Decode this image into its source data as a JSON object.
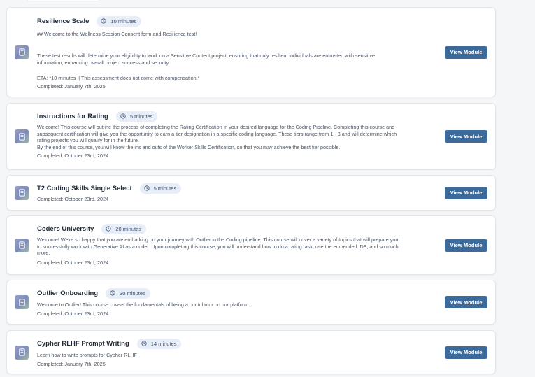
{
  "modules": [
    {
      "title": "Resilience Scale",
      "duration": "10 minutes",
      "description_lines": [
        "## Welcome to the Wellness Session Consent form and Resilience test!",
        "",
        "",
        "These test results will determine your eligibility to work on a Sensitive Content project, ensuring that only resilient individuals are entrusted with sensitive",
        "information, enhancing overall project success and security.",
        "",
        "ETA: *10 minutes || This assessment does not come with compensation.*"
      ],
      "completed": "Completed: January 7th, 2025",
      "button": "View Module"
    },
    {
      "title": "Instructions for Rating",
      "duration": "5 minutes",
      "description_lines": [
        "Welcome! This course will outline the process of completing the Rating Certification in your desired language for the Coding Pipeline. Completing this course and",
        "subsequent certification will give you the opportunity to earn a tier designation in a specific coding language. These tiers range from 1 - 3 and will determine which",
        "rating projects you will qualify for in the future.",
        "By the end of this course, you will know the ins and outs of the Worker Skills Certification, so that you may achieve the best tier possible."
      ],
      "completed": "Completed: October 23rd, 2024",
      "button": "View Module"
    },
    {
      "title": "T2 Coding Skills Single Select",
      "duration": "5 minutes",
      "description_lines": [],
      "completed": "Completed: October 23rd, 2024",
      "button": "View Module"
    },
    {
      "title": "Coders University",
      "duration": "20 minutes",
      "description_lines": [
        "Welcome! We're so happy that you are embarking on your journey with Outlier in the Coding pipeline. This course will cover a variety of topics that will prepare you",
        "to successfully work with Generative AI as a coder. Upon completing this course, you will understand how to do a rating task, use the embedded IDE, and so much",
        "more."
      ],
      "completed": "Completed: October 23rd, 2024",
      "button": "View Module"
    },
    {
      "title": "Outlier Onboarding",
      "duration": "30 minutes",
      "description_lines": [
        "Welcome to Outlier! This course covers the fundamentals of being a contributor on our platform."
      ],
      "completed": "Completed: October 23rd, 2024",
      "button": "View Module"
    },
    {
      "title": "Cypher RLHF Prompt Writing",
      "duration": "14 minutes",
      "description_lines": [
        "Learn how to write prompts for Cypher RLHF"
      ],
      "completed": "Completed: January 7th, 2025",
      "button": "View Module"
    }
  ],
  "icons": {
    "module": "book-icon",
    "duration": "clock-icon"
  },
  "colors": {
    "button": "#3c6a9a",
    "badge_bg": "#e8eef7",
    "badge_text": "#3a4e70"
  }
}
